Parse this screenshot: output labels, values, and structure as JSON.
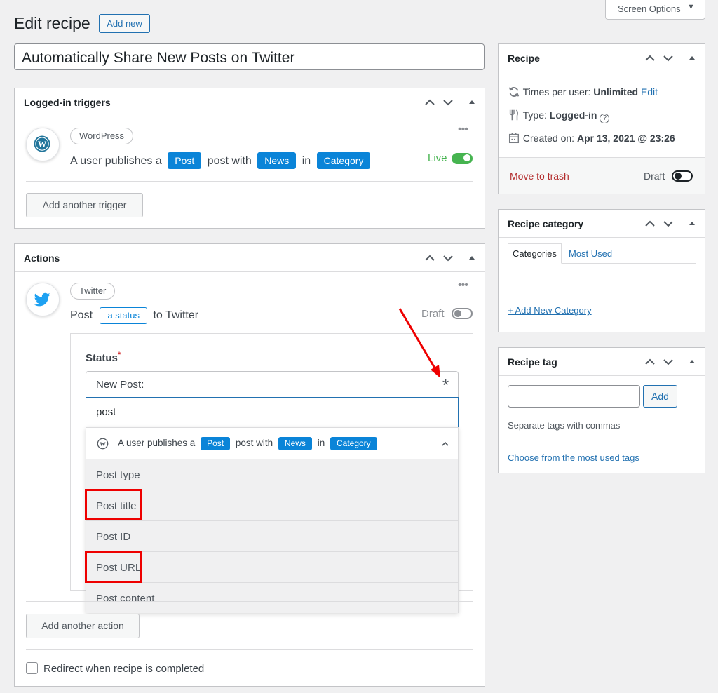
{
  "header": {
    "title": "Edit recipe",
    "add_new": "Add new",
    "screen_options": "Screen Options"
  },
  "recipe_title": "Automatically Share New Posts on Twitter",
  "triggers": {
    "title": "Logged-in triggers",
    "integration": "WordPress",
    "sentence": {
      "p1": "A user publishes a",
      "tok1": "Post",
      "p2": "post with",
      "tok2": "News",
      "p3": "in",
      "tok3": "Category"
    },
    "status": "Live",
    "add_button": "Add another trigger"
  },
  "actions": {
    "title": "Actions",
    "integration": "Twitter",
    "sentence": {
      "p1": "Post",
      "tok1": "a status",
      "p2": "to Twitter"
    },
    "status": "Draft",
    "field_label": "Status",
    "required_mark": "*",
    "field_value": "New Post:",
    "asterisk_button": "*",
    "search_value": "post",
    "dropdown_header": {
      "p1": "A user publishes a",
      "tok1": "Post",
      "p2": "post with",
      "tok2": "News",
      "p3": "in",
      "tok3": "Category"
    },
    "options": [
      "Post type",
      "Post title",
      "Post ID",
      "Post URL",
      "Post content"
    ],
    "add_button": "Add another action",
    "redirect_label": "Redirect when recipe is completed"
  },
  "recipe_box": {
    "title": "Recipe",
    "times_label": "Times per user:",
    "times_value": "Unlimited",
    "times_edit": "Edit",
    "type_label": "Type:",
    "type_value": "Logged-in",
    "created_label": "Created on:",
    "created_value": "Apr 13, 2021 @ 23:26",
    "trash": "Move to trash",
    "draft": "Draft"
  },
  "category_box": {
    "title": "Recipe category",
    "tab_categories": "Categories",
    "tab_most_used": "Most Used",
    "add_new": "+ Add New Category"
  },
  "tag_box": {
    "title": "Recipe tag",
    "input_value": "",
    "add": "Add",
    "hint": "Separate tags with commas",
    "choose": "Choose from the most used tags"
  },
  "colors": {
    "accent": "#0a84d8",
    "live": "#46b450",
    "trash": "#b32d2e",
    "highlight": "#e00000"
  }
}
